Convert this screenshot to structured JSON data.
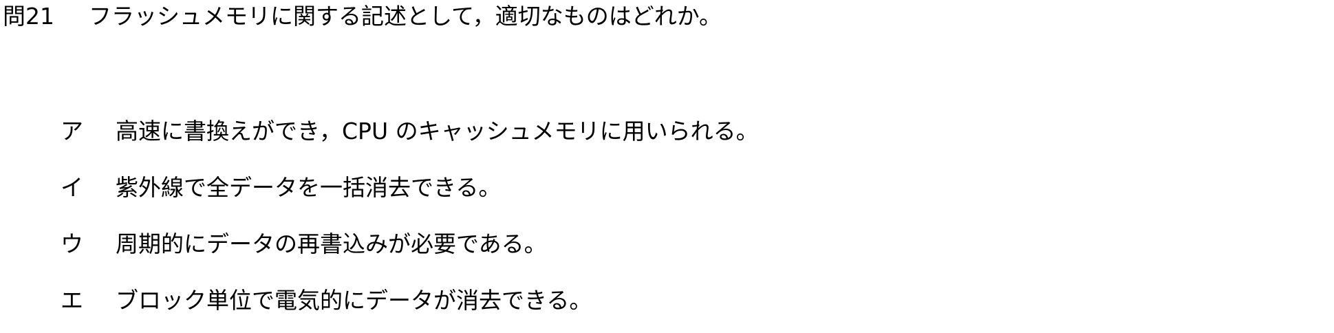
{
  "question": {
    "number": "問21",
    "text": "フラッシュメモリに関する記述として，適切なものはどれか。"
  },
  "options": [
    {
      "label": "ア",
      "text": "高速に書換えができ，CPU のキャッシュメモリに用いられる。"
    },
    {
      "label": "イ",
      "text": "紫外線で全データを一括消去できる。"
    },
    {
      "label": "ウ",
      "text": "周期的にデータの再書込みが必要である。"
    },
    {
      "label": "エ",
      "text": "ブロック単位で電気的にデータが消去できる。"
    }
  ]
}
